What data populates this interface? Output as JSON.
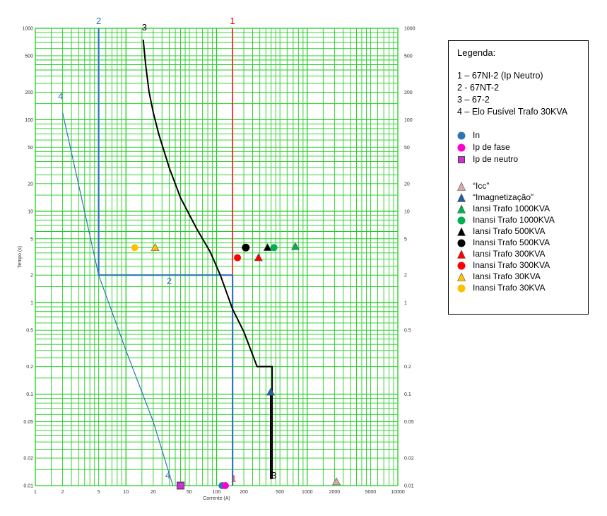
{
  "chart_data": {
    "type": "line",
    "xlabel": "Corrente (A)",
    "ylabel": "Tempo (s)",
    "xscale": "log",
    "yscale": "log",
    "xlim": [
      1,
      10000
    ],
    "ylim": [
      0.01,
      1000
    ],
    "grid": true,
    "x_tick_labels": [
      "1",
      "2",
      "5",
      "10",
      "20",
      "50",
      "100",
      "200",
      "500",
      "1000",
      "2000",
      "5000",
      "10000"
    ],
    "x_tick_values": [
      1,
      2,
      5,
      10,
      20,
      50,
      100,
      200,
      500,
      1000,
      2000,
      5000,
      10000
    ],
    "y_tick_labels": [
      "0.01",
      "0.02",
      "0.05",
      "0.1",
      "0.2",
      "0.5",
      "1",
      "2",
      "5",
      "10",
      "20",
      "50",
      "100",
      "200",
      "500",
      "1000"
    ],
    "y_tick_values": [
      0.01,
      0.02,
      0.05,
      0.1,
      0.2,
      0.5,
      1,
      2,
      5,
      10,
      20,
      50,
      100,
      200,
      500,
      1000
    ],
    "curves": [
      {
        "label": "1",
        "color": "#ff0000",
        "width": 1.5,
        "points": [
          [
            150,
            1000
          ],
          [
            150,
            0.01
          ]
        ],
        "label_top": [
          150,
          1000
        ],
        "label_bottom": [
          155,
          0.011
        ]
      },
      {
        "label": "2",
        "color": "#2e75b6",
        "width": 2.2,
        "points": [
          [
            5,
            1000
          ],
          [
            5,
            2
          ],
          [
            150,
            2
          ],
          [
            150,
            0.01
          ]
        ],
        "label_top": [
          5,
          1000
        ],
        "label_mid": [
          30,
          1.6
        ]
      },
      {
        "label": "3",
        "color": "#000000",
        "width": 2,
        "points": [
          [
            15.5,
            750
          ],
          [
            16.5,
            400
          ],
          [
            18,
            200
          ],
          [
            20,
            120
          ],
          [
            23,
            70
          ],
          [
            30,
            30
          ],
          [
            40,
            14
          ],
          [
            60,
            6.5
          ],
          [
            85,
            3.6
          ],
          [
            110,
            2.0
          ],
          [
            150,
            0.85
          ],
          [
            200,
            0.48
          ],
          [
            280,
            0.2
          ],
          [
            410,
            0.2
          ],
          [
            410,
            0.012
          ],
          [
            395,
            0.012
          ],
          [
            395,
            0.1
          ]
        ],
        "label_top": [
          16,
          850
        ],
        "label_bottom": [
          430,
          0.012
        ]
      },
      {
        "label": "4",
        "color": "#2e75b6",
        "width": 1.2,
        "points": [
          [
            2,
            120
          ],
          [
            5,
            2
          ],
          [
            10,
            0.3
          ],
          [
            20,
            0.05
          ],
          [
            33,
            0.01
          ]
        ],
        "label_top": [
          1.9,
          150
        ],
        "label_bottom": [
          29,
          0.012
        ]
      }
    ],
    "markers": [
      {
        "legend": "In",
        "shape": "circle",
        "color": "#2e75b6",
        "x": 115,
        "y": 0.01
      },
      {
        "legend": "Ip de fase",
        "shape": "circle",
        "color": "#ff00cc",
        "x": 125,
        "y": 0.01
      },
      {
        "legend": "Ip de neutro",
        "shape": "square",
        "color": "#cc33cc",
        "x": 40,
        "y": 0.01
      },
      {
        "legend": "Icc",
        "shape": "triangle",
        "color": "#d9a8a8",
        "x": 2100,
        "y": 0.011
      },
      {
        "legend": "Imagnetização",
        "shape": "triangle",
        "color": "#1f5fa8",
        "x": 395,
        "y": 0.105
      },
      {
        "legend": "Iansi Trafo 1000KVA",
        "shape": "triangle",
        "color": "#00b050",
        "x": 740,
        "y": 4.1
      },
      {
        "legend": "Inansi Trafo 1000KVA",
        "shape": "circle",
        "color": "#00b050",
        "x": 430,
        "y": 4.0
      },
      {
        "legend": "Iansi Trafo 500KVA",
        "shape": "triangle",
        "color": "#000000",
        "x": 365,
        "y": 4.0
      },
      {
        "legend": "Inansi Trafo 500KVA",
        "shape": "circle",
        "color": "#000000",
        "x": 210,
        "y": 4.0
      },
      {
        "legend": "Iansi Trafo 300KVA",
        "shape": "triangle",
        "color": "#ff0000",
        "x": 290,
        "y": 3.1
      },
      {
        "legend": "Inansi Trafo 300KVA",
        "shape": "circle",
        "color": "#ff0000",
        "x": 170,
        "y": 3.1
      },
      {
        "legend": "Iansi Trafo 30KVA",
        "shape": "triangle",
        "color": "#ffc000",
        "x": 21,
        "y": 4.0
      },
      {
        "legend": "Inansi Trafo 30KVA",
        "shape": "circle",
        "color": "#ffc000",
        "x": 12.5,
        "y": 4.0
      }
    ]
  },
  "legend": {
    "title": "Legenda:",
    "curves": [
      "1 – 67NI-2 (Ip Neutro)",
      "2 - 67NT-2",
      "3 – 67-2",
      "4 – Elo Fusível Trafo 30KVA"
    ],
    "markers": [
      {
        "label": "In",
        "shape": "circle",
        "color": "#2e75b6"
      },
      {
        "label": "Ip de fase",
        "shape": "circle",
        "color": "#ff00cc"
      },
      {
        "label": "Ip de neutro",
        "shape": "square",
        "color": "#cc33cc"
      },
      {
        "label": "“Icc”",
        "shape": "triangle",
        "color": "#d9a8a8"
      },
      {
        "label": "“Imagnetização”",
        "shape": "triangle",
        "color": "#1f5fa8"
      },
      {
        "label": "Iansi Trafo 1000KVA",
        "shape": "triangle",
        "color": "#00b050"
      },
      {
        "label": "Inansi Trafo 1000KVA",
        "shape": "circle",
        "color": "#00b050"
      },
      {
        "label": "Iansi Trafo 500KVA",
        "shape": "triangle",
        "color": "#000000"
      },
      {
        "label": "Inansi Trafo 500KVA",
        "shape": "circle",
        "color": "#000000"
      },
      {
        "label": "Iansi Trafo 300KVA",
        "shape": "triangle",
        "color": "#ff0000"
      },
      {
        "label": "Inansi Trafo 300KVA",
        "shape": "circle",
        "color": "#ff0000"
      },
      {
        "label": "Iansi Trafo 30KVA",
        "shape": "triangle",
        "color": "#ffc000"
      },
      {
        "label": "Inansi Trafo 30KVA",
        "shape": "circle",
        "color": "#ffc000"
      }
    ]
  },
  "colors": {
    "grid": "#22cc22",
    "background": "#ffffff"
  }
}
